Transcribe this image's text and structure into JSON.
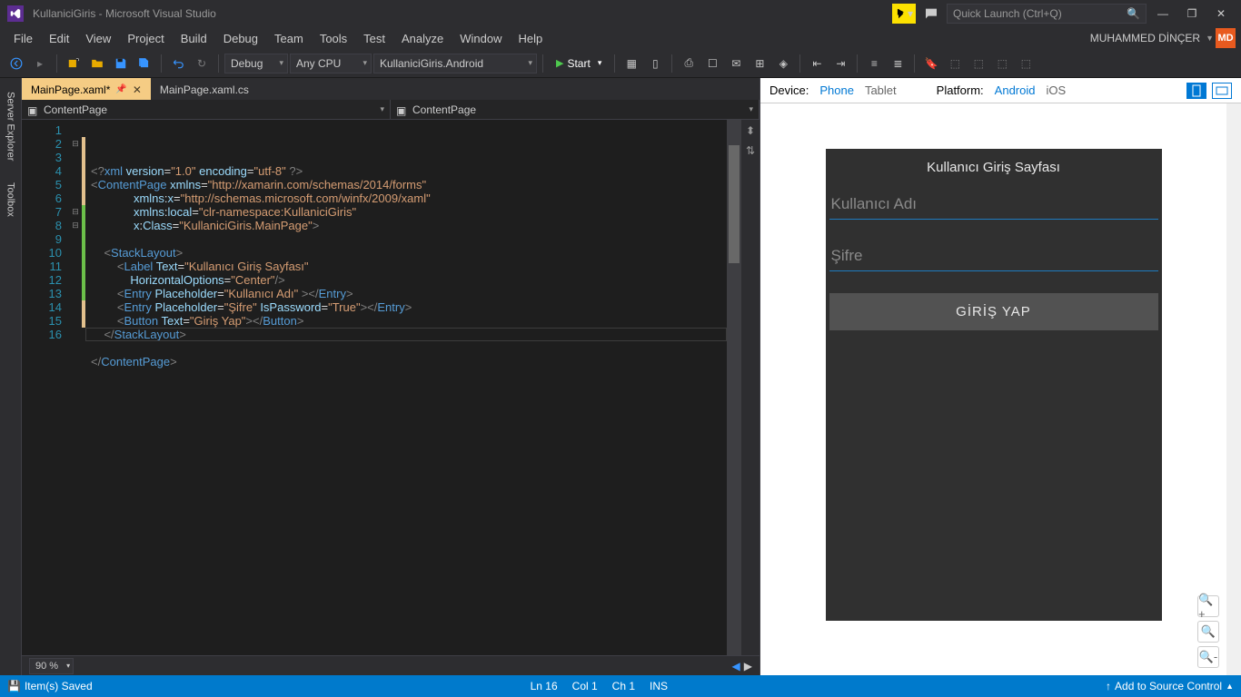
{
  "window": {
    "title": "KullaniciGiris - Microsoft Visual Studio"
  },
  "quicklaunch": {
    "placeholder": "Quick Launch (Ctrl+Q)"
  },
  "menu": {
    "items": [
      "File",
      "Edit",
      "View",
      "Project",
      "Build",
      "Debug",
      "Team",
      "Tools",
      "Test",
      "Analyze",
      "Window",
      "Help"
    ]
  },
  "user": {
    "name": "MUHAMMED DİNÇER",
    "initials": "MD"
  },
  "toolbar": {
    "config": "Debug",
    "platform": "Any CPU",
    "project": "KullaniciGiris.Android",
    "start": "Start"
  },
  "side_tools": {
    "tabs": [
      "Server Explorer",
      "Toolbox"
    ]
  },
  "doc_tabs": {
    "items": [
      {
        "label": "MainPage.xaml*",
        "active": true
      },
      {
        "label": "MainPage.xaml.cs",
        "active": false
      }
    ]
  },
  "nav": {
    "left": "ContentPage",
    "right": "ContentPage"
  },
  "code": {
    "lines": [
      {
        "n": 1,
        "html": "<span class='c-gray'>&lt;?</span><span class='c-blue'>xml</span> <span class='c-attr'>version</span>=<span class='c-str'>\"1.0\"</span> <span class='c-attr'>encoding</span>=<span class='c-str'>\"utf-8\"</span> <span class='c-gray'>?&gt;</span>",
        "fold": ""
      },
      {
        "n": 2,
        "html": "<span class='c-gray'>&lt;</span><span class='c-blue'>ContentPage</span> <span class='c-attr'>xmlns</span>=<span class='c-str'>\"http://xamarin.com/schemas/2014/forms\"</span>",
        "fold": "⊟",
        "change": "mod"
      },
      {
        "n": 3,
        "html": "             <span class='c-attr'>xmlns</span>:<span class='c-attr'>x</span>=<span class='c-str'>\"http://schemas.microsoft.com/winfx/2009/xaml\"</span>",
        "change": "mod"
      },
      {
        "n": 4,
        "html": "             <span class='c-attr'>xmlns</span>:<span class='c-attr'>local</span>=<span class='c-str'>\"clr-namespace:KullaniciGiris\"</span>",
        "change": "mod"
      },
      {
        "n": 5,
        "html": "             <span class='c-attr'>x</span>:<span class='c-attr'>Class</span>=<span class='c-str'>\"KullaniciGiris.MainPage\"</span><span class='c-gray'>&gt;</span>",
        "change": "mod"
      },
      {
        "n": 6,
        "html": "",
        "change": "mod"
      },
      {
        "n": 7,
        "html": "    <span class='c-gray'>&lt;</span><span class='c-blue'>StackLayout</span><span class='c-gray'>&gt;</span>",
        "fold": "⊟",
        "change": "add"
      },
      {
        "n": 8,
        "html": "        <span class='c-gray'>&lt;</span><span class='c-blue'>Label</span> <span class='c-attr'>Text</span>=<span class='c-str'>\"Kullanıcı Giriş Sayfası\"</span>",
        "fold": "⊟",
        "change": "add"
      },
      {
        "n": 9,
        "html": "            <span class='c-attr'>HorizontalOptions</span>=<span class='c-str'>\"Center\"</span><span class='c-gray'>/&gt;</span>",
        "change": "add"
      },
      {
        "n": 10,
        "html": "        <span class='c-gray'>&lt;</span><span class='c-blue'>Entry</span> <span class='c-attr'>Placeholder</span>=<span class='c-str'>\"Kullanıcı Adı\"</span> <span class='c-gray'>&gt;&lt;/</span><span class='c-blue'>Entry</span><span class='c-gray'>&gt;</span>",
        "change": "add"
      },
      {
        "n": 11,
        "html": "        <span class='c-gray'>&lt;</span><span class='c-blue'>Entry</span> <span class='c-attr'>Placeholder</span>=<span class='c-str'>\"Şifre\"</span> <span class='c-attr'>IsPassword</span>=<span class='c-str'>\"True\"</span><span class='c-gray'>&gt;&lt;/</span><span class='c-blue'>Entry</span><span class='c-gray'>&gt;</span>",
        "change": "add"
      },
      {
        "n": 12,
        "html": "        <span class='c-gray'>&lt;</span><span class='c-blue'>Button</span> <span class='c-attr'>Text</span>=<span class='c-str'>\"Giriş Yap\"</span><span class='c-gray'>&gt;&lt;/</span><span class='c-blue'>Button</span><span class='c-gray'>&gt;</span>",
        "change": "add"
      },
      {
        "n": 13,
        "html": "    <span class='c-gray'>&lt;/</span><span class='c-blue'>StackLayout</span><span class='c-gray'>&gt;</span>",
        "change": "add"
      },
      {
        "n": 14,
        "html": "",
        "change": "mod"
      },
      {
        "n": 15,
        "html": "<span class='c-gray'>&lt;/</span><span class='c-blue'>ContentPage</span><span class='c-gray'>&gt;</span>",
        "change": "mod"
      },
      {
        "n": 16,
        "html": ""
      }
    ]
  },
  "zoom": {
    "value": "90 %"
  },
  "preview": {
    "device_label": "Device:",
    "device_phone": "Phone",
    "device_tablet": "Tablet",
    "platform_label": "Platform:",
    "platform_android": "Android",
    "platform_ios": "iOS",
    "app_title": "Kullanıcı Giriş Sayfası",
    "entry_user": "Kullanıcı Adı",
    "entry_pass": "Şifre",
    "button": "GİRİŞ YAP"
  },
  "status": {
    "saved": "Item(s) Saved",
    "ln": "Ln 16",
    "col": "Col 1",
    "ch": "Ch 1",
    "ins": "INS",
    "source_control": "Add to Source Control"
  }
}
